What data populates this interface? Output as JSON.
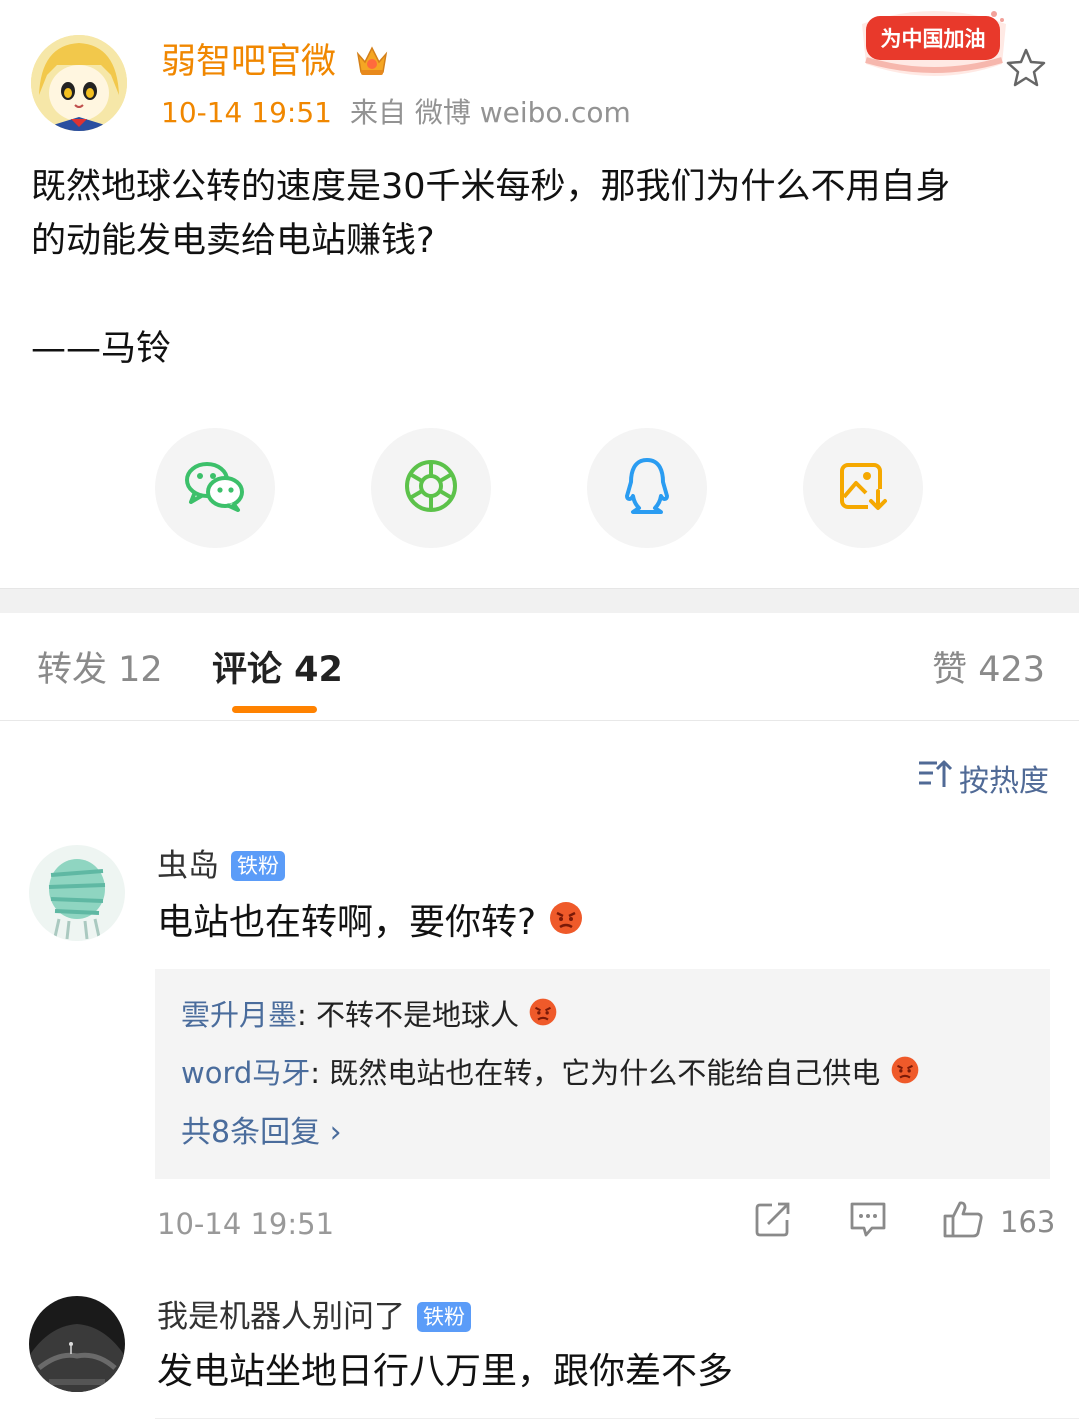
{
  "post": {
    "username": "弱智吧官微",
    "time": "10-14 19:51",
    "source": "来自 微博 weibo.com",
    "badge_text": "为中国加油",
    "text": "既然地球公转的速度是30千米每秒，那我们为什么不用自身\n的动能发电卖给电站赚钱?\n\n——马铃"
  },
  "share": [
    {
      "name": "wechat-icon",
      "color": "#3cc06a"
    },
    {
      "name": "moments-icon",
      "color": "#5cc24a"
    },
    {
      "name": "qq-icon",
      "color": "#2a9cf1"
    },
    {
      "name": "save-image-icon",
      "color": "#f5a800"
    }
  ],
  "tabs": {
    "repost": "转发 12",
    "comment": "评论 42",
    "like": "赞 423"
  },
  "sort_label": "按热度",
  "comments": [
    {
      "user": "虫岛",
      "badge": "铁粉",
      "text": "电站也在转啊，要你转?",
      "replies": [
        {
          "user": "雲升月墨",
          "text": "不转不是地球人"
        },
        {
          "user": "word马牙",
          "text": "既然电站也在转，它为什么不能给自己供电"
        }
      ],
      "more_replies": "共8条回复 ›",
      "time": "10-14 19:51",
      "likes": "163"
    },
    {
      "user": "我是机器人别问了",
      "badge": "铁粉",
      "text": "发电站坐地日行八万里，跟你差不多"
    }
  ],
  "colors": {
    "accent": "#f08700",
    "link": "#4a6c9c",
    "tab_underline": "#ff8200",
    "fan_badge": "#5b9cf8"
  }
}
